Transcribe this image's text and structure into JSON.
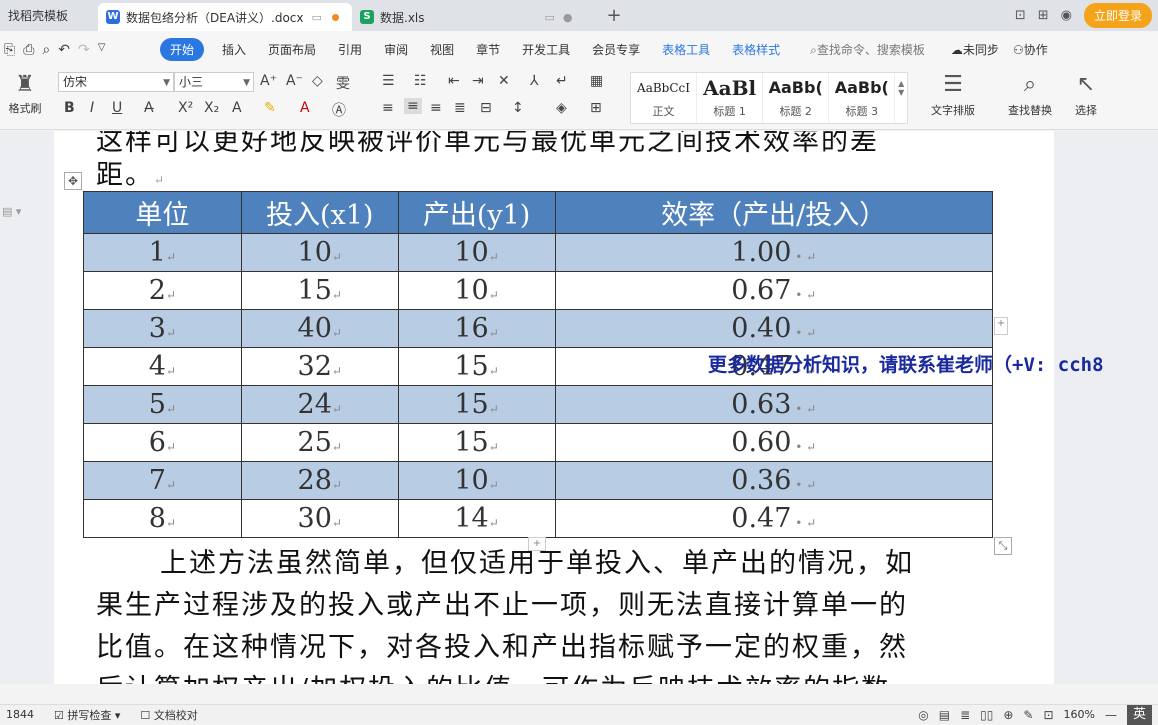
{
  "tabs": [
    {
      "label": "找稻壳模板"
    },
    {
      "label": "数据包络分析（DEA讲义）.docx"
    },
    {
      "label": "数据.xls"
    }
  ],
  "tabbar_right": {
    "login_label": "立即登录"
  },
  "menu": {
    "items": [
      "开始",
      "插入",
      "页面布局",
      "引用",
      "审阅",
      "视图",
      "章节",
      "开发工具",
      "会员专享"
    ],
    "context_items": [
      "表格工具",
      "表格样式"
    ],
    "search_placeholder": "查找命令、搜索模板",
    "sync_label": "未同步",
    "collab_label": "协作"
  },
  "ribbon": {
    "format_brush_label": "格式刷",
    "font_name": "仿宋",
    "font_size": "小三",
    "styles": [
      {
        "preview": "AaBbCcI",
        "label": "正文"
      },
      {
        "preview": "AaBl",
        "label": "标题 1"
      },
      {
        "preview": "AaBb(",
        "label": "标题 2"
      },
      {
        "preview": "AaBb(",
        "label": "标题 3"
      }
    ],
    "text_layout_label": "文字排版",
    "find_replace_label": "查找替换",
    "select_label": "选择"
  },
  "document": {
    "line_top_cut": "这样可以更好地反映被评价单元与最优单元之间技术效率的差",
    "line_top_end": "距。",
    "table": {
      "headers": [
        "单位",
        "投入(x1)",
        "产出(y1)",
        "效率（产出/投入）"
      ],
      "rows": [
        [
          "1",
          "10",
          "10",
          "1.00"
        ],
        [
          "2",
          "15",
          "10",
          "0.67"
        ],
        [
          "3",
          "40",
          "16",
          "0.40"
        ],
        [
          "4",
          "32",
          "15",
          "0.47"
        ],
        [
          "5",
          "24",
          "15",
          "0.63"
        ],
        [
          "6",
          "25",
          "15",
          "0.60"
        ],
        [
          "7",
          "28",
          "10",
          "0.36"
        ],
        [
          "8",
          "30",
          "14",
          "0.47"
        ]
      ]
    },
    "para_lines": [
      "上述方法虽然简单，但仅适用于单投入、单产出的情况，如",
      "果生产过程涉及的投入或产出不止一项，则无法直接计算单一的",
      "比值。在这种情况下，对各投入和产出指标赋予一定的权重，然",
      "后计算加权产出/加权投入的比值，可作为反映技术效率的指数"
    ],
    "watermark": "更多数据分析知识，请联系崔老师（+V: cch8"
  },
  "statusbar": {
    "page_info": "1844",
    "spell_check": "拼写检查",
    "doc_proof": "文档校对",
    "zoom": "160%",
    "ime": "英"
  }
}
